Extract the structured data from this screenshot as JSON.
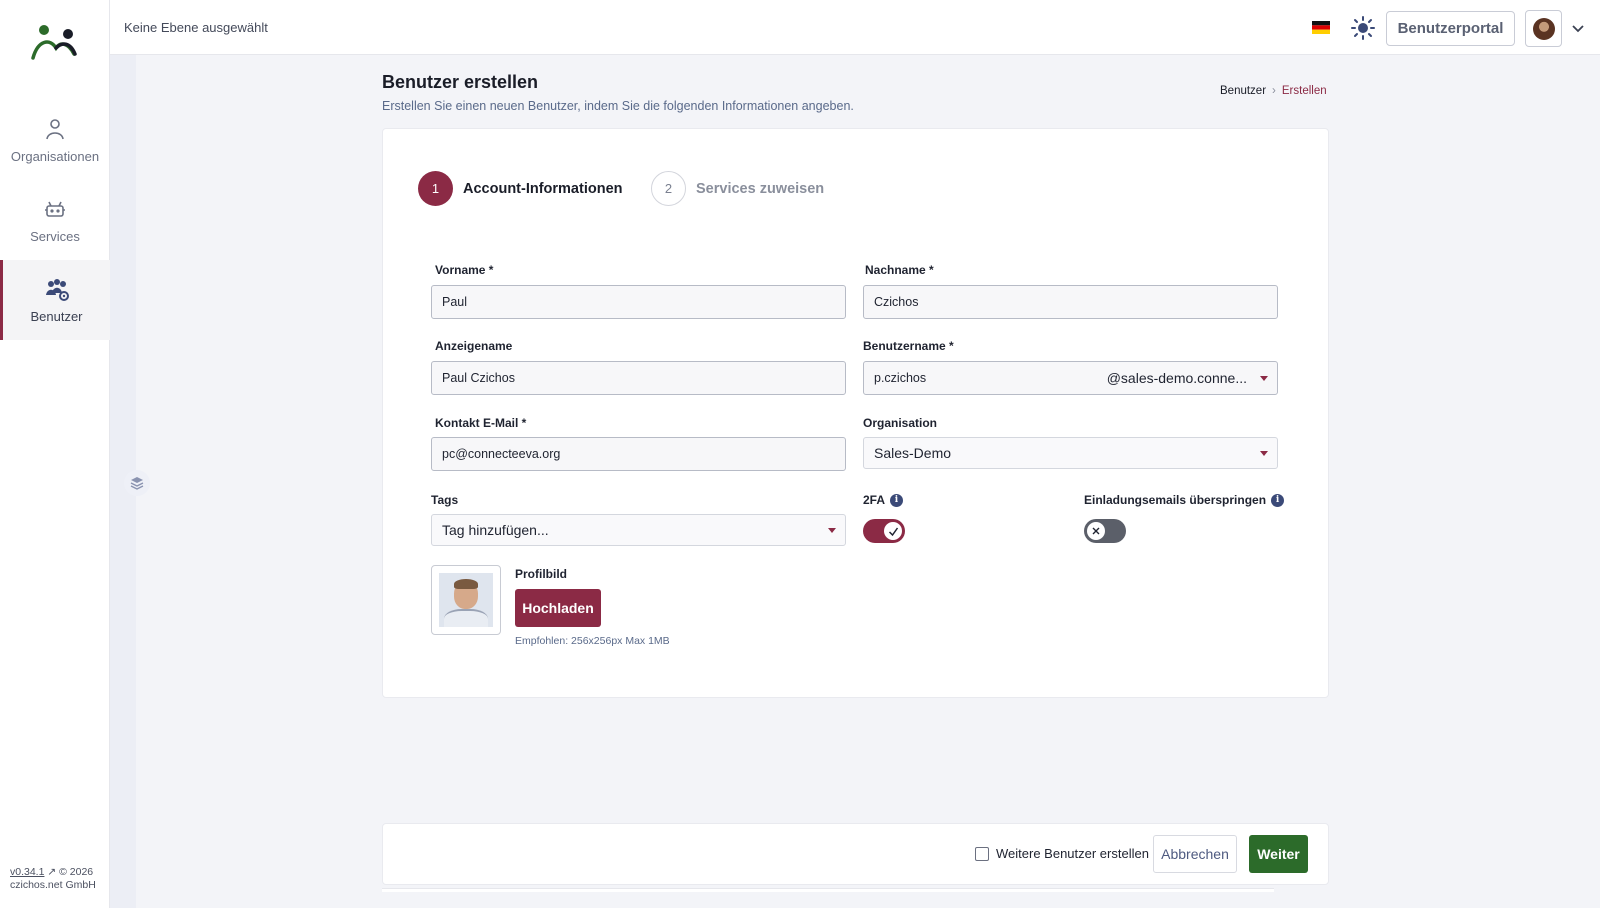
{
  "header": {
    "level_text": "Keine Ebene ausgewählt",
    "language_icon": "german-flag-icon",
    "theme_icon": "sun-icon",
    "portal_label": "Benutzerportal"
  },
  "sidebar": {
    "items": [
      {
        "label": "Organisationen",
        "icon": "organization-icon",
        "active": false
      },
      {
        "label": "Services",
        "icon": "services-icon",
        "active": false
      },
      {
        "label": "Benutzer",
        "icon": "users-icon",
        "active": true
      }
    ],
    "version": "v0.34.1",
    "copyright": "© 2026",
    "company": "czichos.net GmbH"
  },
  "page": {
    "title": "Benutzer erstellen",
    "subtitle": "Erstellen Sie einen neuen Benutzer, indem Sie die folgenden Informationen angeben.",
    "breadcrumb": [
      "Benutzer",
      "Erstellen"
    ]
  },
  "stepper": [
    {
      "num": "1",
      "label": "Account-Informationen",
      "active": true
    },
    {
      "num": "2",
      "label": "Services zuweisen",
      "active": false
    }
  ],
  "form": {
    "vorname": {
      "label": "Vorname *",
      "value": "Paul"
    },
    "nachname": {
      "label": "Nachname *",
      "value": "Czichos"
    },
    "anzeigename": {
      "label": "Anzeigename",
      "value": "Paul Czichos"
    },
    "benutzername": {
      "label": "Benutzername *",
      "value": "p.czichos",
      "domain": "@sales-demo.conne..."
    },
    "email": {
      "label": "Kontakt E-Mail *",
      "value": "pc@connecteeva.org"
    },
    "organisation": {
      "label": "Organisation",
      "value": "Sales-Demo"
    },
    "tags": {
      "label": "Tags",
      "placeholder": "Tag hinzufügen..."
    },
    "twofa": {
      "label": "2FA",
      "enabled": true
    },
    "skip_invite": {
      "label": "Einladungsemails überspringen",
      "enabled": false
    },
    "profile": {
      "label": "Profilbild",
      "upload_label": "Hochladen",
      "hint": "Empfohlen: 256x256px Max 1MB"
    }
  },
  "footer": {
    "more_users_label": "Weitere Benutzer erstellen",
    "more_users_checked": false,
    "cancel_label": "Abbrechen",
    "next_label": "Weiter"
  },
  "colors": {
    "brand": "#8b2a45",
    "primary_action": "#2c6b2a",
    "logo_green": "#2c6b2a"
  }
}
